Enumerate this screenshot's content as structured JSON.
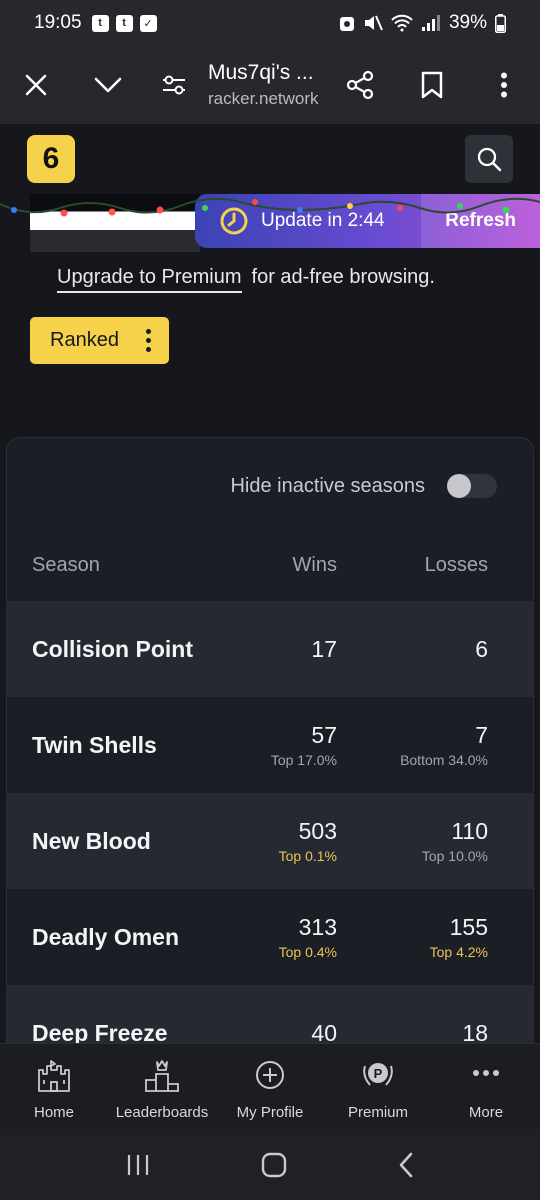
{
  "status": {
    "time": "19:05",
    "battery": "39%",
    "notification_icons": [
      "twitch-icon",
      "twitch-icon",
      "check-icon"
    ]
  },
  "browser": {
    "title": "Mus7qi's ...",
    "host": "racker.network"
  },
  "update": {
    "text": "Update in 2:44",
    "refresh_label": "Refresh"
  },
  "upgrade": {
    "link": "Upgrade to Premium",
    "rest": "for ad-free browsing."
  },
  "ranked_label": "Ranked",
  "card": {
    "toggle_label": "Hide inactive seasons",
    "toggle_on": false,
    "columns": [
      "Season",
      "Wins",
      "Losses"
    ],
    "rows": [
      {
        "season": "Collision Point",
        "wins": "17",
        "wins_rank": "",
        "wins_gold": false,
        "losses": "6",
        "losses_rank": "",
        "losses_gold": false
      },
      {
        "season": "Twin Shells",
        "wins": "57",
        "wins_rank": "Top 17.0%",
        "wins_gold": false,
        "losses": "7",
        "losses_rank": "Bottom 34.0%",
        "losses_gold": false
      },
      {
        "season": "New Blood",
        "wins": "503",
        "wins_rank": "Top 0.1%",
        "wins_gold": true,
        "losses": "110",
        "losses_rank": "Top 10.0%",
        "losses_gold": false
      },
      {
        "season": "Deadly Omen",
        "wins": "313",
        "wins_rank": "Top 0.4%",
        "wins_gold": true,
        "losses": "155",
        "losses_rank": "Top 4.2%",
        "losses_gold": true
      },
      {
        "season": "Deep Freeze",
        "wins": "40",
        "wins_rank": "",
        "wins_gold": false,
        "losses": "18",
        "losses_rank": "",
        "losses_gold": false
      }
    ]
  },
  "nav": [
    {
      "label": "Home",
      "icon": "castle-icon"
    },
    {
      "label": "Leaderboards",
      "icon": "podium-icon"
    },
    {
      "label": "My Profile",
      "icon": "plus-circle-icon"
    },
    {
      "label": "Premium",
      "icon": "premium-badge-icon"
    },
    {
      "label": "More",
      "icon": "more-dots-icon"
    }
  ],
  "colors": {
    "accent": "#f6d24a",
    "background": "#15171d",
    "card": "#1c1e25",
    "row_alt": "#262932",
    "gold_text": "#e8c656"
  }
}
